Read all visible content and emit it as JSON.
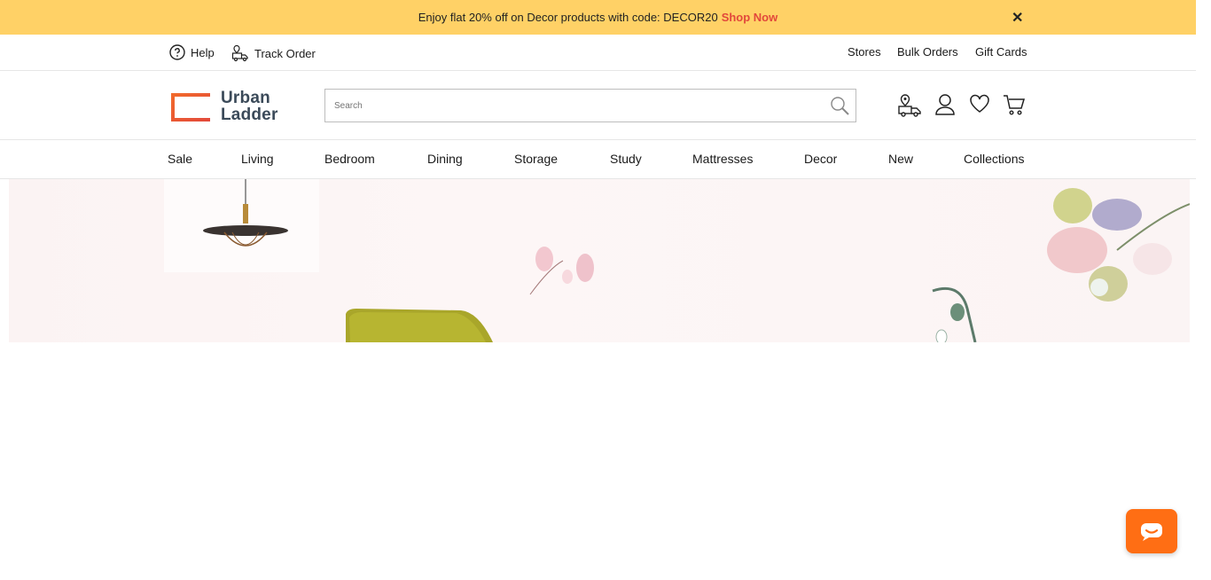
{
  "promo": {
    "text": "Enjoy flat 20% off on Decor products with code: DECOR20",
    "cta": "Shop Now",
    "close_glyph": "✕"
  },
  "util": {
    "help": "Help",
    "track_order": "Track Order",
    "stores": "Stores",
    "bulk_orders": "Bulk Orders",
    "gift_cards": "Gift Cards"
  },
  "logo": {
    "line1": "Urban",
    "line2": "Ladder"
  },
  "search": {
    "placeholder": "Search"
  },
  "nav": {
    "items": [
      "Sale",
      "Living",
      "Bedroom",
      "Dining",
      "Storage",
      "Study",
      "Mattresses",
      "Decor",
      "New",
      "Collections"
    ]
  },
  "colors": {
    "promo_bg": "#ffd166",
    "promo_cta": "#e2483b",
    "chat_bg": "#ff6e14",
    "logo_orange": "#f26b2b"
  },
  "icons": [
    "help-icon",
    "track-order-icon",
    "close-icon",
    "search-icon",
    "store-locator-icon",
    "account-icon",
    "wishlist-icon",
    "cart-icon",
    "chat-icon"
  ]
}
